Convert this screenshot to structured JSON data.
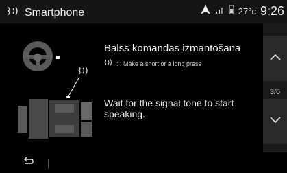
{
  "header": {
    "title": "Smartphone",
    "temperature": "27°c",
    "time": "9:26",
    "status_icons": [
      "navigation-arrow-icon",
      "signal-bars-icon",
      "phone-battery-icon"
    ]
  },
  "main": {
    "title": "Balss komandas izmantošana",
    "hint": ": : Make a short or a long press",
    "instruction": "Wait for the signal tone to start speaking."
  },
  "scroll": {
    "page_indicator": "3/6"
  },
  "footer": {
    "back_icon": "back-arrow-icon"
  },
  "colors": {
    "header_bg": "#151515",
    "panel_bg": "#2a2a2a",
    "illustration_gray": "#5a5a5a",
    "text": "#f0f0f0"
  }
}
